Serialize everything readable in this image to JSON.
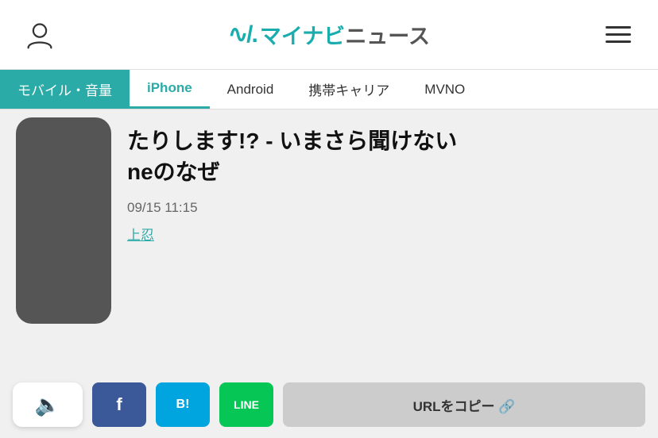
{
  "header": {
    "user_icon_label": "user account",
    "logo_wave": "∿",
    "logo_brand": "マイナビ",
    "logo_news": "ニュース",
    "menu_label": "menu"
  },
  "nav": {
    "tabs": [
      {
        "id": "mobile",
        "label": "モバイル・音量",
        "active": true
      },
      {
        "id": "iphone",
        "label": "iPhone",
        "selected": true
      },
      {
        "id": "android",
        "label": "Android",
        "selected": false
      },
      {
        "id": "carrier",
        "label": "携帯キャリア",
        "selected": false
      },
      {
        "id": "mvno",
        "label": "MVNO",
        "selected": false
      }
    ]
  },
  "article": {
    "title_line1": "たりします!? - いまさら聞けない",
    "title_line2": "neのなぜ",
    "date": "09/15 11:15",
    "author": "上忍"
  },
  "share_bar": {
    "sound_icon": "🔈",
    "facebook_label": "f",
    "hatena_label": "B!",
    "line_label": "LINE",
    "url_copy_label": "URLをコピー 🔗"
  }
}
